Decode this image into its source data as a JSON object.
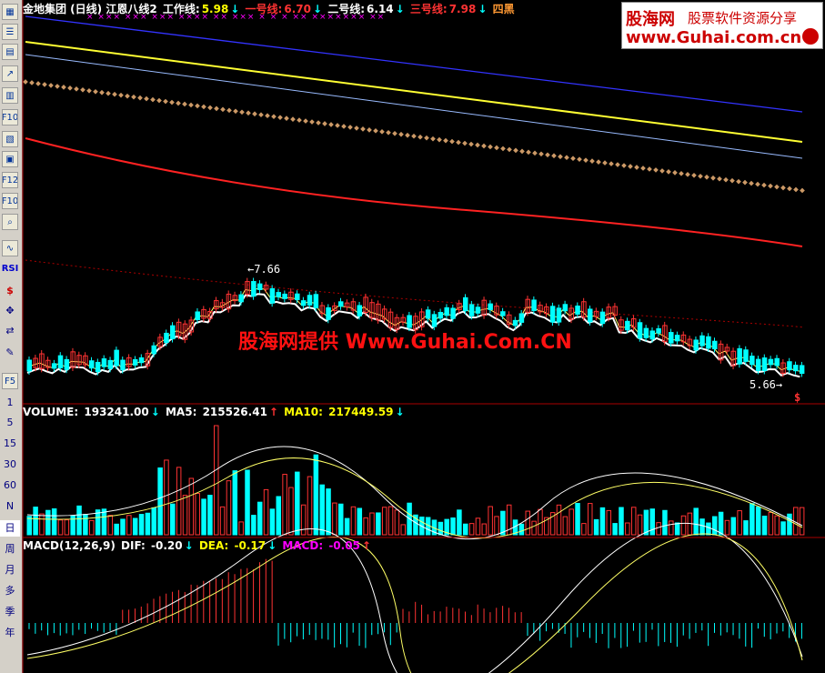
{
  "toolbar": {
    "items": [
      {
        "name": "toolbar-grid-icon",
        "label": ""
      },
      {
        "name": "toolbar-list-icon",
        "label": ""
      },
      {
        "name": "toolbar-table-icon",
        "label": ""
      },
      {
        "name": "toolbar-trend-icon",
        "label": ""
      },
      {
        "name": "toolbar-kline-icon",
        "label": ""
      },
      {
        "name": "toolbar-window-icon",
        "label": ""
      },
      {
        "name": "toolbar-f10-icon",
        "label": "F10"
      },
      {
        "name": "toolbar-doc-icon",
        "label": ""
      },
      {
        "name": "toolbar-info-icon",
        "label": ""
      },
      {
        "name": "toolbar-f12-icon",
        "label": "F12"
      },
      {
        "name": "toolbar-f10b-icon",
        "label": "F10"
      },
      {
        "name": "toolbar-zoom-icon",
        "label": ""
      },
      {
        "name": "toolbar-wave-icon",
        "label": ""
      }
    ],
    "rsi": "RSI",
    "dollar": "$",
    "periods": [
      "1",
      "5",
      "15",
      "30",
      "60",
      "N",
      "日",
      "周",
      "月",
      "多",
      "季",
      "年"
    ]
  },
  "price_panel": {
    "title": "金地集团 (日线)  江恩八线2",
    "work_line_label": "工作线:",
    "work_line_value": "5.98",
    "line1_label": "一号线:",
    "line1_value": "6.70",
    "line2_label": "二号线:",
    "line2_value": "6.14",
    "line3_label": "三号线:",
    "line3_value": "7.98",
    "line4_label": "四黑",
    "high_label": "7.66",
    "low_label": "5.66",
    "marks": "×  ×××  ×××      ×××     ××××  ××                                   ×××            ×  ×   ×       ××   ×××××××          ××"
  },
  "volume_panel": {
    "label": "VOLUME:",
    "value": "193241.00",
    "ma5_label": "MA5:",
    "ma5_value": "215526.41",
    "ma10_label": "MA10:",
    "ma10_value": "217449.59"
  },
  "macd_panel": {
    "label": "MACD(12,26,9)",
    "dif_label": "DIF:",
    "dif_value": "-0.20",
    "dea_label": "DEA:",
    "dea_value": "-0.17",
    "macd_label": "MACD:",
    "macd_value": "-0.05"
  },
  "logo": {
    "brand": "股海网",
    "slogan": "股票软件资源分享",
    "url": "www.Guhai.com.cn"
  },
  "watermark": "股海网提供 Www.Guhai.Com.CN",
  "colors": {
    "up": "#ff3333",
    "down": "#00ffff",
    "line_blue": "#3333ff",
    "line_yellow": "#ffff33",
    "line_lightblue": "#99bbff",
    "line_diamond": "#cc9966",
    "line_red": "#ff2222",
    "ma_white": "#ffffff"
  },
  "chart_data": {
    "type": "candlestick",
    "high": 7.66,
    "low": 5.66,
    "gann_lines": {
      "work": 5.98,
      "line1": 6.7,
      "line2": 6.14,
      "line3": 7.98
    },
    "volume": {
      "last": 193241.0,
      "ma5": 215526.41,
      "ma10": 217449.59
    },
    "macd": {
      "dif": -0.2,
      "dea": -0.17,
      "macd": -0.05
    }
  }
}
